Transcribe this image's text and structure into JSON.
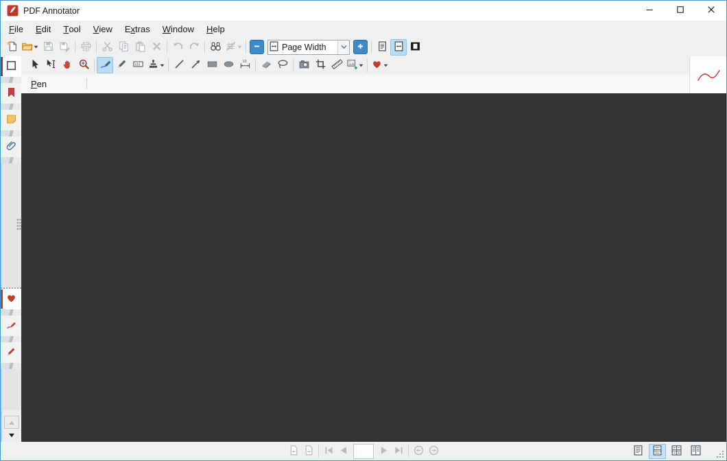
{
  "window": {
    "title": "PDF Annotator",
    "controls": [
      {
        "name": "minimize"
      },
      {
        "name": "maximize"
      },
      {
        "name": "close"
      }
    ]
  },
  "menu": {
    "items": [
      {
        "label": "File",
        "underline": 0
      },
      {
        "label": "Edit",
        "underline": 0
      },
      {
        "label": "Tool",
        "underline": 0
      },
      {
        "label": "View",
        "underline": 0
      },
      {
        "label": "Extras",
        "underline": 1
      },
      {
        "label": "Window",
        "underline": 0
      },
      {
        "label": "Help",
        "underline": 0
      }
    ]
  },
  "toolbar_main": {
    "zoom_value": "Page Width",
    "items": [
      {
        "name": "new-document",
        "icon": "new-document",
        "state": "color"
      },
      {
        "name": "open-document",
        "icon": "open-folder",
        "state": "color",
        "dropdown": true
      },
      {
        "name": "save",
        "icon": "save",
        "state": "disabled"
      },
      {
        "name": "save-as",
        "icon": "save-as",
        "state": "disabled"
      },
      {
        "sep": true
      },
      {
        "name": "print",
        "icon": "print",
        "state": "disabled"
      },
      {
        "sep": true
      },
      {
        "name": "cut",
        "icon": "cut",
        "state": "disabled"
      },
      {
        "name": "copy",
        "icon": "copy",
        "state": "disabled"
      },
      {
        "name": "paste",
        "icon": "paste",
        "state": "disabled"
      },
      {
        "name": "delete",
        "icon": "delete",
        "state": "disabled"
      },
      {
        "sep": true
      },
      {
        "name": "undo",
        "icon": "undo",
        "state": "disabled"
      },
      {
        "name": "redo",
        "icon": "redo",
        "state": "disabled"
      },
      {
        "sep": true
      },
      {
        "name": "find",
        "icon": "find",
        "state": "enabled"
      },
      {
        "name": "manage-annotations",
        "icon": "annotations",
        "state": "disabled",
        "dropdown": true
      },
      {
        "sep": true
      },
      {
        "name": "zoom-out",
        "icon": "minus-white",
        "state": "accent"
      },
      {
        "combo": true,
        "name": "zoom-level-select"
      },
      {
        "name": "zoom-in",
        "icon": "plus-white",
        "state": "accent"
      },
      {
        "sep": true
      },
      {
        "name": "fit-page",
        "icon": "fit-page",
        "state": "enabled"
      },
      {
        "name": "fit-width",
        "icon": "page-width",
        "state": "selected"
      },
      {
        "name": "full-screen",
        "icon": "full-screen",
        "state": "color"
      }
    ]
  },
  "toolbar_tools": {
    "items": [
      {
        "name": "select-tool",
        "icon": "select",
        "state": "color"
      },
      {
        "name": "text-select-tool",
        "icon": "text-select",
        "state": "enabled"
      },
      {
        "name": "hand-tool",
        "icon": "hand",
        "state": "color"
      },
      {
        "name": "zoom-tool",
        "icon": "zoom-tool",
        "state": "color"
      },
      {
        "sep": true
      },
      {
        "name": "pen-tool",
        "icon": "pen",
        "state": "selected"
      },
      {
        "name": "marker-tool",
        "icon": "marker",
        "state": "color"
      },
      {
        "name": "text-box-tool",
        "icon": "text-box",
        "state": "enabled"
      },
      {
        "name": "stamp-tool",
        "icon": "stamp",
        "state": "enabled",
        "dropdown": true
      },
      {
        "sep": true
      },
      {
        "name": "line-tool",
        "icon": "line",
        "state": "enabled"
      },
      {
        "name": "arrow-tool",
        "icon": "arrow",
        "state": "enabled"
      },
      {
        "name": "rectangle-tool",
        "icon": "rect-shape",
        "state": "color"
      },
      {
        "name": "ellipse-tool",
        "icon": "ellipse-shape",
        "state": "color"
      },
      {
        "name": "dimension-tool",
        "icon": "dimension",
        "state": "enabled"
      },
      {
        "sep": true
      },
      {
        "name": "eraser-tool",
        "icon": "eraser",
        "state": "color"
      },
      {
        "name": "lasso-tool",
        "icon": "lasso",
        "state": "enabled"
      },
      {
        "sep": true
      },
      {
        "name": "snapshot-tool",
        "icon": "camera",
        "state": "color"
      },
      {
        "name": "crop-tool",
        "icon": "crop",
        "state": "enabled"
      },
      {
        "name": "ruler-tool",
        "icon": "ruler",
        "state": "enabled"
      },
      {
        "name": "add-image-tool",
        "icon": "image-add",
        "state": "color",
        "dropdown": true
      },
      {
        "sep": true
      },
      {
        "name": "favorites-tool",
        "icon": "heart",
        "state": "color",
        "dropdown": true
      }
    ]
  },
  "pen_bar": {
    "label": "Pen",
    "underline": 0
  },
  "style_preview": {
    "name": "pen-style-preview",
    "color": "#c0392b"
  },
  "sidebar": {
    "top_tabs": [
      {
        "name": "page-thumbnails",
        "icon": "square-outline",
        "active": true,
        "accent": "#8e4040"
      },
      {
        "name": "bookmarks",
        "icon": "bookmark",
        "active": false
      },
      {
        "name": "annotations-notes",
        "icon": "note",
        "active": false
      },
      {
        "name": "attachments",
        "icon": "paperclip",
        "active": false
      }
    ],
    "bottom_tabs": [
      {
        "name": "favorites-presets",
        "icon": "heart",
        "active": true,
        "accent": "#c23b2e"
      },
      {
        "name": "pen-presets",
        "icon": "pen-small",
        "active": false
      },
      {
        "name": "marker-presets",
        "icon": "marker-small",
        "active": false
      }
    ]
  },
  "statusbar": {
    "page_value": "",
    "nav": [
      {
        "name": "previous-document",
        "icon": "page-prev",
        "state": "disabled"
      },
      {
        "name": "next-document",
        "icon": "page-next",
        "state": "disabled"
      },
      {
        "sep": true
      },
      {
        "name": "first-page",
        "icon": "nav-first",
        "state": "disabled"
      },
      {
        "name": "previous-page",
        "icon": "nav-prev",
        "state": "disabled"
      },
      {
        "input": true,
        "name": "page-number"
      },
      {
        "name": "next-page",
        "icon": "nav-next",
        "state": "disabled"
      },
      {
        "name": "last-page",
        "icon": "nav-last",
        "state": "disabled"
      },
      {
        "sep": true
      },
      {
        "name": "back",
        "icon": "circle-back",
        "state": "disabled"
      },
      {
        "name": "forward",
        "icon": "circle-forward",
        "state": "disabled"
      }
    ],
    "views": [
      {
        "name": "single-page-view",
        "icon": "view-single",
        "selected": false
      },
      {
        "name": "continuous-view",
        "icon": "view-continuous",
        "selected": true
      },
      {
        "name": "continuous-facing-view",
        "icon": "view-two-continuous",
        "selected": false
      },
      {
        "name": "facing-view",
        "icon": "view-two-pages",
        "selected": false
      }
    ]
  },
  "colors": {
    "canvas": "#333336",
    "accent_blue": "#3e8cc7",
    "selection_bg": "#b9dcf5",
    "heart_red": "#c23b2e",
    "window_border": "#3a9ad9"
  }
}
